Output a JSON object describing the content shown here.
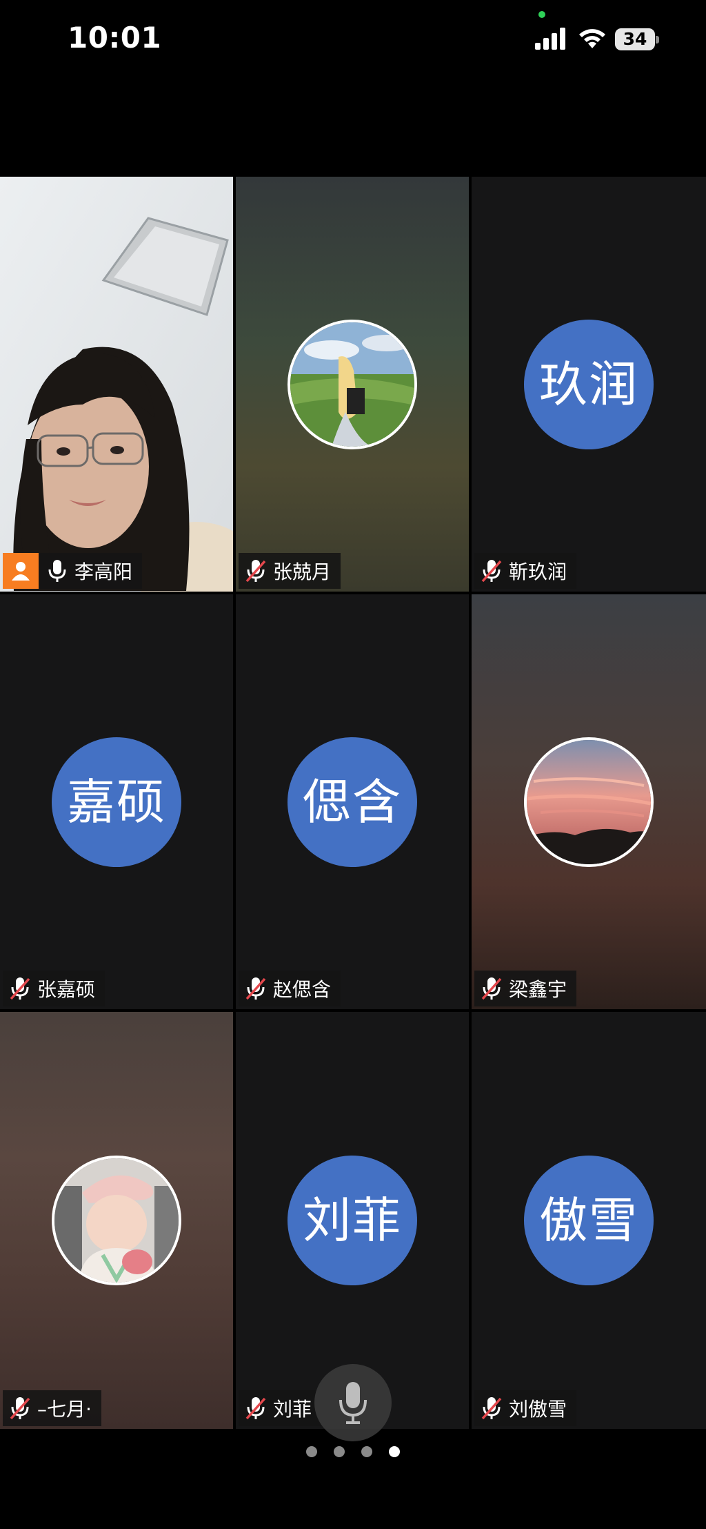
{
  "status_bar": {
    "time": "10:01",
    "battery": "34",
    "icons": [
      "signal-icon",
      "wifi-icon",
      "battery-icon"
    ]
  },
  "participants": [
    {
      "name": "李高阳",
      "avatar": "",
      "video": true,
      "muted": false,
      "host": true
    },
    {
      "name": "张兢月",
      "avatar": "",
      "photo": "meadow-girl",
      "muted": true
    },
    {
      "name": "靳玖润",
      "avatar": "玖润",
      "muted": true
    },
    {
      "name": "张嘉硕",
      "avatar": "嘉硕",
      "muted": true
    },
    {
      "name": "赵偲含",
      "avatar": "偲含",
      "muted": true
    },
    {
      "name": "梁鑫宇",
      "avatar": "",
      "photo": "sunset",
      "muted": true
    },
    {
      "name": "–七月·",
      "avatar": "",
      "photo": "child",
      "muted": true
    },
    {
      "name": "刘菲",
      "avatar": "刘菲",
      "muted": true
    },
    {
      "name": "刘傲雪",
      "avatar": "傲雪",
      "muted": true
    }
  ],
  "pagination": {
    "pages": 4,
    "current": 4
  },
  "colors": {
    "avatar_blue": "#4471c4",
    "active_speaker_border": "#1fcb64",
    "host_badge": "#f77d21",
    "mute_slash": "#e5484d"
  }
}
